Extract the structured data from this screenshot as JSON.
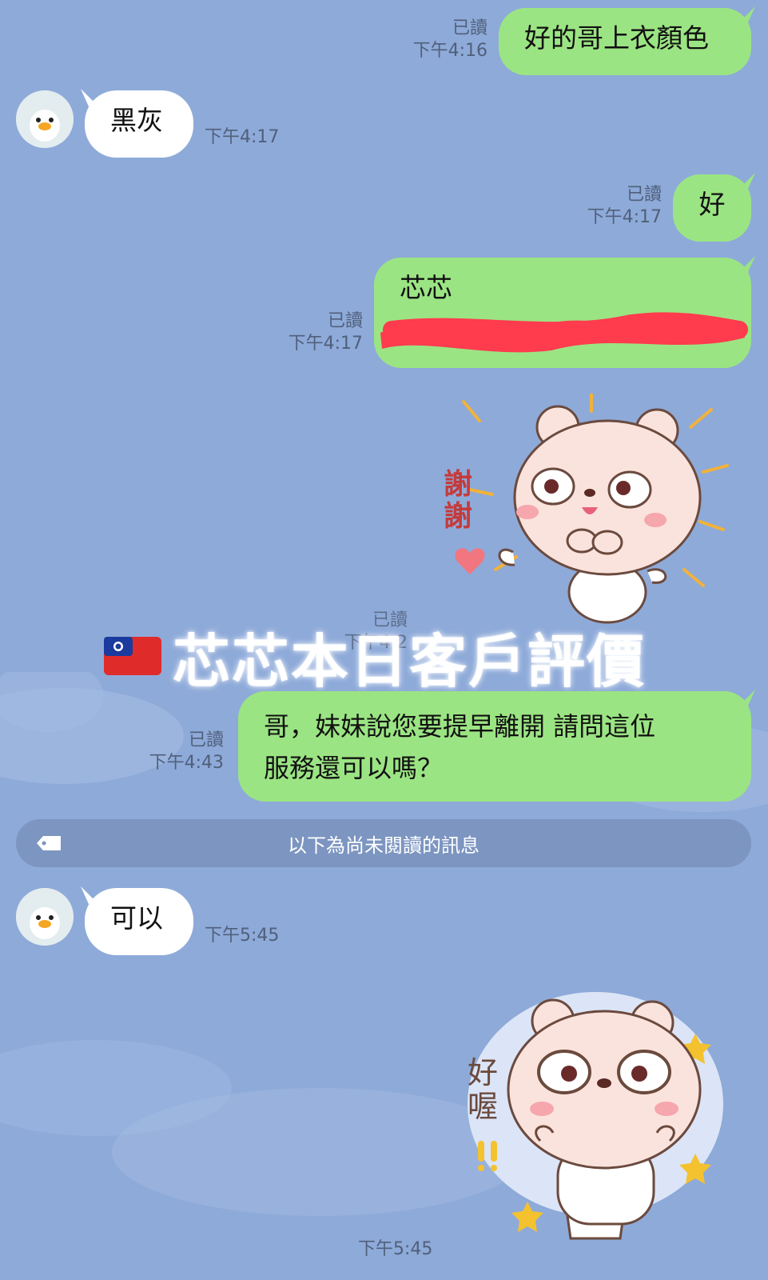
{
  "colors": {
    "background": "#8eaad9",
    "outgoing_bubble": "#9be483",
    "incoming_bubble": "#ffffff",
    "divider": "#7c95c1",
    "redaction": "#ff3b4e"
  },
  "messages": [
    {
      "side": "out",
      "text": "好的哥上衣顏色",
      "read": "已讀",
      "time": "下午4:16"
    },
    {
      "side": "in",
      "avatar_icon": "penguin-avatar-icon",
      "text": "黑灰",
      "time": "下午4:17"
    },
    {
      "side": "out",
      "text": "好",
      "read": "已讀",
      "time": "下午4:17"
    },
    {
      "side": "out",
      "text": "芯芯",
      "redacted": true,
      "read": "已讀",
      "time": "下午4:17"
    },
    {
      "side": "out",
      "sticker": "bear-thank-you-sticker",
      "sticker_text": "謝謝",
      "read": "已讀",
      "time": "下午4:2"
    },
    {
      "side": "out",
      "text_line1": "哥，妹妹說您要提早離開 請問這位",
      "text_line2": "服務還可以嗎？",
      "read": "已讀",
      "time": "下午4:43"
    },
    {
      "side": "in",
      "avatar_icon": "penguin-avatar-icon",
      "text": "可以",
      "time": "下午5:45"
    },
    {
      "side": "in",
      "sticker": "bear-okay-sticker",
      "sticker_text": "好喔",
      "time": "下午5:45"
    }
  ],
  "unread_divider": {
    "text": "以下為尚未閱讀的訊息",
    "icon": "tag-icon"
  },
  "overlay": {
    "flag_icon": "taiwan-flag-icon",
    "title": "芯芯本日客戶評價"
  }
}
